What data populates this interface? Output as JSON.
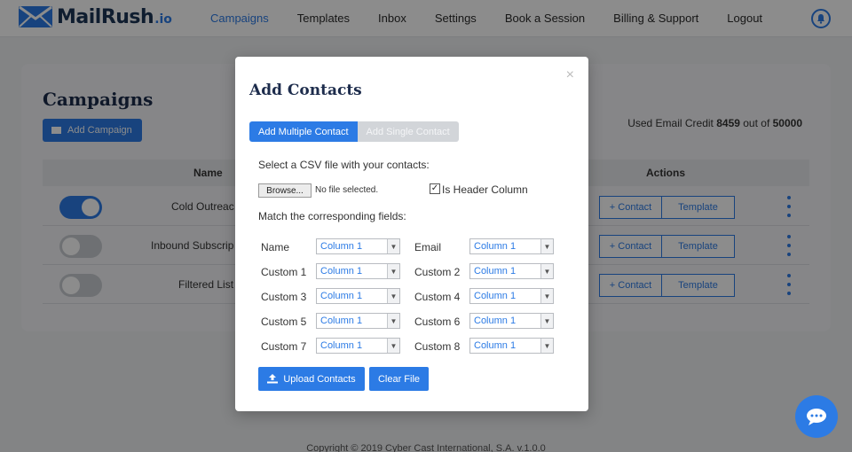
{
  "nav": {
    "logo": "MailRush",
    "logo_tld": ".io",
    "links": [
      "Campaigns",
      "Templates",
      "Inbox",
      "Settings",
      "Book a Session",
      "Billing & Support",
      "Logout"
    ]
  },
  "page": {
    "title": "Campaigns",
    "add_campaign": "Add Campaign",
    "credit_prefix": "Used Email Credit ",
    "credit_used": "8459",
    "credit_mid": " out of ",
    "credit_total": "50000",
    "col_name": "Name",
    "col_actions": "Actions",
    "rows": [
      {
        "name": "Cold Outreac",
        "enabled": true
      },
      {
        "name": "Inbound Subscrip",
        "enabled": false
      },
      {
        "name": "Filtered List",
        "enabled": false
      }
    ],
    "contact_btn": "+ Contact",
    "template_btn": "Template",
    "footer": "Copyright © 2019 Cyber Cast International, S.A. v.1.0.0"
  },
  "modal": {
    "close": "×",
    "title": "Add Contacts",
    "tab_multiple": "Add Multiple Contact",
    "tab_single": "Add Single Contact",
    "select_csv": "Select a CSV file with your contacts:",
    "browse": "Browse...",
    "no_file": "No file selected.",
    "header_check": "✓",
    "header_label": "Is Header Column",
    "match_fields": "Match the corresponding fields:",
    "fields": [
      {
        "label": "Name",
        "value": "Column 1"
      },
      {
        "label": "Email",
        "value": "Column 1"
      },
      {
        "label": "Custom 1",
        "value": "Column 1"
      },
      {
        "label": "Custom 2",
        "value": "Column 1"
      },
      {
        "label": "Custom 3",
        "value": "Column 1"
      },
      {
        "label": "Custom 4",
        "value": "Column 1"
      },
      {
        "label": "Custom 5",
        "value": "Column 1"
      },
      {
        "label": "Custom 6",
        "value": "Column 1"
      },
      {
        "label": "Custom 7",
        "value": "Column 1"
      },
      {
        "label": "Custom 8",
        "value": "Column 1"
      }
    ],
    "upload": "Upload Contacts",
    "clear": "Clear File"
  },
  "colors": {
    "accent": "#2c7be5",
    "dark": "#1d2c4c"
  }
}
